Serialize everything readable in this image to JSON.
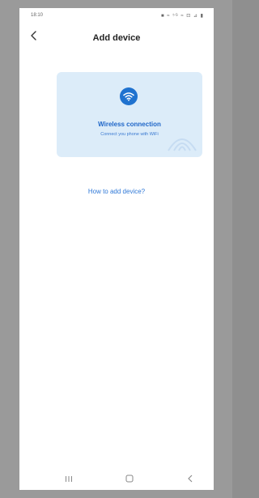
{
  "status_bar": {
    "time": "18:10",
    "icons": "■ ≈ ⁵ᴳ ≈ ⊡ ⊿ ▮"
  },
  "header": {
    "title": "Add device",
    "back_icon": "chevron-left-icon"
  },
  "connection_card": {
    "icon": "wifi-icon",
    "title": "Wireless connection",
    "subtitle": "Connect you phone with WiFi",
    "accent_color": "#1f72cf",
    "background_color": "#dcecf9"
  },
  "help_link": {
    "label": "How to add device?"
  },
  "nav_bar": {
    "recents_icon": "recents-icon",
    "home_icon": "home-icon",
    "back_icon": "back-icon"
  }
}
